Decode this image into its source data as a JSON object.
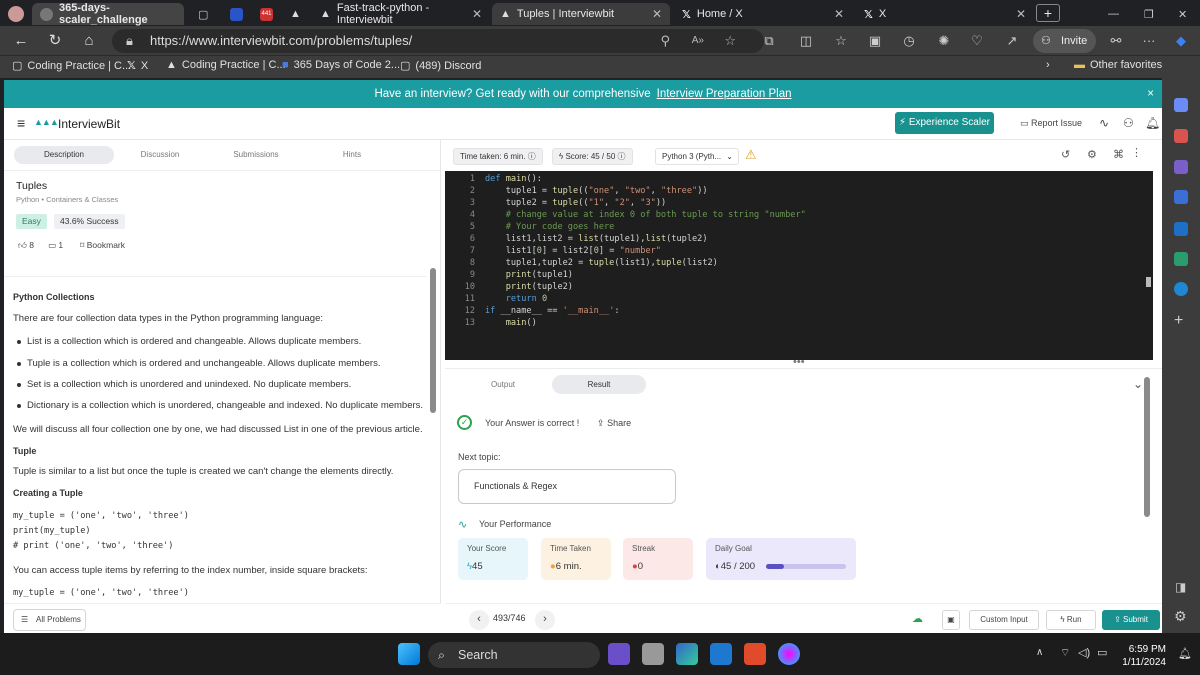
{
  "browser": {
    "tabs": [
      {
        "label": "365-days-scaler_challenge",
        "active": false
      },
      {
        "label": "Fast-track-python - Interviewbit",
        "active": false
      },
      {
        "label": "Tuples | Interviewbit",
        "active": true
      },
      {
        "label": "Home / X",
        "active": false
      },
      {
        "label": "X",
        "active": false
      }
    ],
    "tab_badge": "441",
    "url": "https://www.interviewbit.com/problems/tuples/",
    "invite_label": "Invite",
    "bookmarks": [
      "Coding Practice | C...",
      "X",
      "Coding Practice | C...",
      "365 Days of Code 2...",
      "(489) Discord"
    ],
    "other_favorites": "Other favorites"
  },
  "banner": {
    "text": "Have an interview? Get ready with our comprehensive",
    "link": "Interview Preparation Plan",
    "close": "×"
  },
  "header": {
    "logo": "InterviewBit",
    "experience_button": "Experience Scaler",
    "report_issue": "Report Issue"
  },
  "left": {
    "tabs": [
      "Description",
      "Discussion",
      "Submissions",
      "Hints"
    ],
    "problem_title": "Tuples",
    "breadcrumb": "Python • Containers & Classes",
    "difficulty": "Easy",
    "success": "43.6% Success",
    "likes": "8",
    "comments": "1",
    "bookmark": "Bookmark",
    "content": {
      "h1": "Python Collections",
      "p1": "There are four collection data types in the Python programming language:",
      "bullets": [
        "List is a collection which is ordered and changeable. Allows duplicate members.",
        "Tuple is a collection which is ordered and unchangeable. Allows duplicate members.",
        "Set is a collection which is unordered and unindexed. No duplicate members.",
        "Dictionary is a collection which is unordered, changeable and indexed. No duplicate members."
      ],
      "p2": "We will discuss all four collection one by one, we had discussed List in one of the previous article.",
      "h2": "Tuple",
      "p3": "Tuple is similar to a list but once the tuple is created we can't change the elements directly.",
      "h3": "Creating a Tuple",
      "code1": [
        "my_tuple = ('one', 'two', 'three')",
        "print(my_tuple)",
        "# print ('one', 'two', 'three')"
      ],
      "p4": "You can access tuple items by referring to the index number, inside square brackets:",
      "code2": "my_tuple = ('one', 'two', 'three')"
    },
    "all_problems": "All Problems"
  },
  "editor": {
    "time_taken": "Time taken: 6 min.",
    "score": "Score: 45 / 50",
    "language": "Python 3 (Pyth...",
    "line_numbers": [
      "1",
      "2",
      "3",
      "4",
      "5",
      "6",
      "7",
      "8",
      "9",
      "10",
      "11",
      "12",
      "13"
    ],
    "lines_text": [
      "def main():",
      "    tuple1 = tuple((\"one\", \"two\", \"three\"))",
      "    tuple2 = tuple((\"1\", \"2\", \"3\"))",
      "    # change value at index 0 of both tuple to string \"number\"",
      "    # Your code goes here",
      "    list1,list2 = list(tuple1),list(tuple2)",
      "    list1[0] = list2[0] = \"number\"",
      "    tuple1,tuple2 = tuple(list1),tuple(list2)",
      "    print(tuple1)",
      "    print(tuple2)",
      "    return 0",
      "if __name__ == '__main__':",
      "    main()"
    ]
  },
  "result": {
    "tabs": [
      "Output",
      "Result"
    ],
    "correct": "Your Answer is correct !",
    "share": "Share",
    "next_topic_label": "Next topic:",
    "next_topic": "Functionals & Regex",
    "performance": "Your Performance",
    "cards": [
      {
        "title": "Your Score",
        "value": "45",
        "color": "#e6f6fb"
      },
      {
        "title": "Time Taken",
        "value": "6 min.",
        "color": "#fdf1e2"
      },
      {
        "title": "Streak",
        "value": "0",
        "color": "#fde8e8"
      },
      {
        "title": "Daily Goal",
        "value": "45 / 200",
        "color": "#ebe8fb"
      }
    ],
    "daily_goal_progress": 0.225
  },
  "bottom": {
    "page": "493/746",
    "custom_input": "Custom Input",
    "run": "Run",
    "submit": "Submit"
  },
  "taskbar": {
    "search": "Search",
    "time": "6:59 PM",
    "date": "1/11/2024"
  },
  "colors": {
    "brand": "#1a9ca1",
    "submit": "#18918f",
    "editor_bg": "#1e1e1e"
  }
}
